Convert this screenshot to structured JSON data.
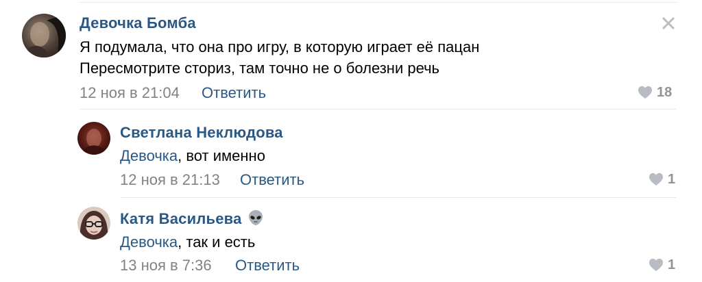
{
  "comments": [
    {
      "author": "Девочка Бомба",
      "lines": [
        "Я подумала, что она про игру, в которую играет её пацан",
        "Пересмотрите сториз, там точно не о болезни речь"
      ],
      "date": "12 ноя в 21:04",
      "reply_label": "Ответить",
      "likes": "18"
    }
  ],
  "replies": [
    {
      "author": "Светлана Неклюдова",
      "mention": "Девочка",
      "text": ", вот именно",
      "date": "12 ноя в 21:13",
      "reply_label": "Ответить",
      "likes": "1"
    },
    {
      "author": "Катя Васильева",
      "author_emoji": "alien-icon",
      "mention": "Девочка",
      "text": ", так и есть",
      "date": "13 ноя в 7:36",
      "reply_label": "Ответить",
      "likes": "1"
    }
  ],
  "icons": {
    "close": "close-icon",
    "like": "heart-icon"
  },
  "colors": {
    "link": "#2a5885",
    "meta": "#828282",
    "like": "#b8bdc4",
    "divider": "#e7e8ec"
  }
}
